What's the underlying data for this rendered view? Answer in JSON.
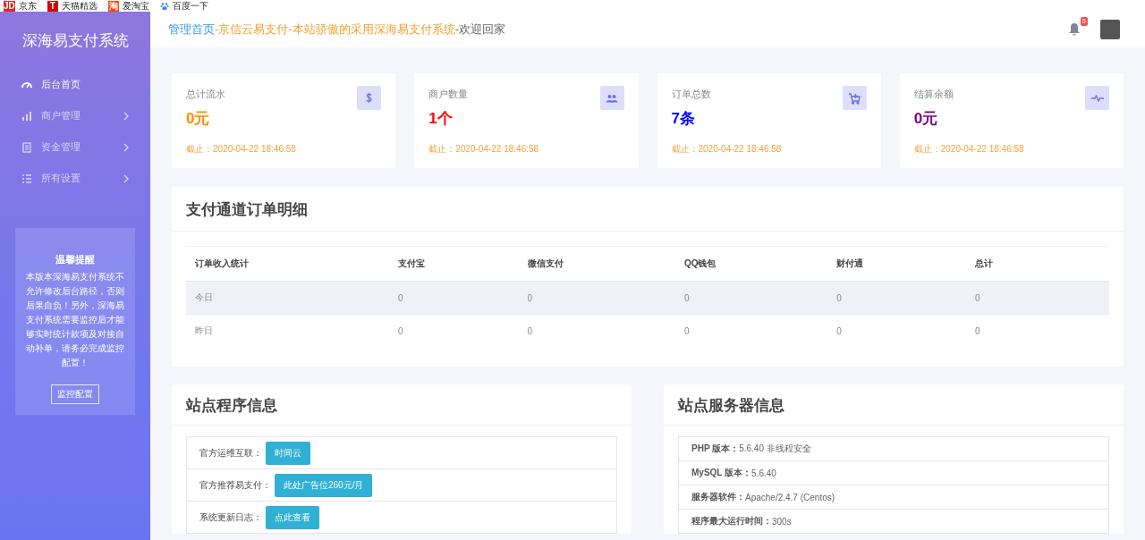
{
  "bookmarks": [
    {
      "label": "京东",
      "icon": "JD",
      "color": "#e1251b"
    },
    {
      "label": "天猫精选",
      "icon": "T",
      "color": "#d40000"
    },
    {
      "label": "爱淘宝",
      "icon": "淘",
      "color": "#ff4400"
    },
    {
      "label": "百度一下",
      "color": "#3385ff"
    }
  ],
  "sidebar": {
    "title": "深海易支付系统",
    "items": [
      {
        "label": "后台首页",
        "selected": true,
        "expandable": false
      },
      {
        "label": "商户管理",
        "selected": false,
        "expandable": true
      },
      {
        "label": "资金管理",
        "selected": false,
        "expandable": true
      },
      {
        "label": "所有设置",
        "selected": false,
        "expandable": true
      }
    ],
    "notice": {
      "title": "温馨提醒",
      "text": "本版本深海易支付系统不允许修改后台路径，否则后果自负！另外，深海易支付系统需要监控后才能够实时统计款项及对接自动补单，请务必完成监控配置！",
      "button": "监控配置"
    }
  },
  "topbar": {
    "breadcrumb": [
      {
        "text": "管理首页",
        "kind": "link"
      },
      {
        "text": "-",
        "kind": "sep"
      },
      {
        "text": "京信云易支付-本站骄傲的采用深海易支付系统",
        "kind": "site"
      },
      {
        "text": "-欢迎回家",
        "kind": "plain"
      }
    ],
    "notification_count": "5"
  },
  "stats": [
    {
      "title": "总计流水",
      "value": "0元",
      "color": "#ff8c00",
      "since": "截止：2020-04-22 18:46:58"
    },
    {
      "title": "商户数量",
      "value": "1个",
      "color": "#ff0000",
      "since": "截止：2020-04-22 18:46:58"
    },
    {
      "title": "订单总数",
      "value": "7条",
      "color": "#0000ff",
      "since": "截止：2020-04-22 18:46:58"
    },
    {
      "title": "结算余额",
      "value": "0元",
      "color": "#800080",
      "since": "截止：2020-04-22 18:46:58"
    }
  ],
  "orders": {
    "title": "支付通道订单明细",
    "table": {
      "columns": [
        "订单收入统计",
        "支付宝",
        "微信支付",
        "QQ钱包",
        "财付通",
        "总计"
      ],
      "rows": [
        {
          "selected": true,
          "cells": [
            "今日",
            "0",
            "0",
            "0",
            "0",
            "0"
          ]
        },
        {
          "selected": false,
          "cells": [
            "昨日",
            "0",
            "0",
            "0",
            "0",
            "0"
          ]
        }
      ]
    }
  },
  "program_info": {
    "title": "站点程序信息",
    "rows": [
      {
        "label": "官方运维互联：",
        "button": "时间云"
      },
      {
        "label": "官方推荐易支付：",
        "button": "此处广告位260元/月"
      },
      {
        "label": "系统更新日志：",
        "button": "点此查看"
      }
    ]
  },
  "server_info": {
    "title": "站点服务器信息",
    "rows": [
      {
        "label": "PHP 版本：",
        "value": "5.6.40 非线程安全"
      },
      {
        "label": "MySQL 版本：",
        "value": "5.6.40"
      },
      {
        "label": "服务器软件：",
        "value": "Apache/2.4.7 (Centos)"
      },
      {
        "label": "程序最大运行时间：",
        "value": "300s"
      }
    ]
  }
}
